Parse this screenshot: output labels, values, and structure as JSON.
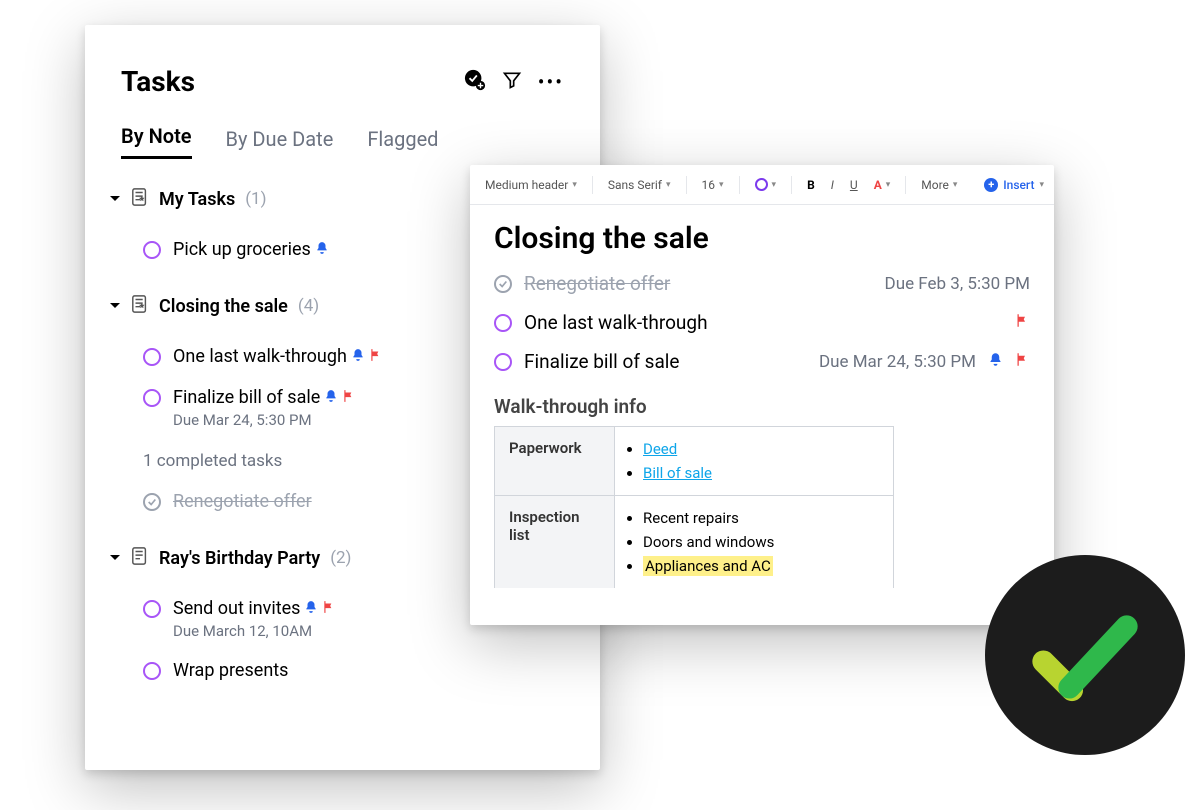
{
  "left": {
    "title": "Tasks",
    "tabs": {
      "byNote": "By Note",
      "byDueDate": "By Due Date",
      "flagged": "Flagged"
    },
    "groups": {
      "myTasks": {
        "name": "My Tasks",
        "count": "(1)",
        "tasks": {
          "t0": {
            "text": "Pick up groceries"
          }
        }
      },
      "closing": {
        "name": "Closing the sale",
        "count": "(4)",
        "tasks": {
          "t0": {
            "text": "One last walk-through"
          },
          "t1": {
            "text": "Finalize bill of sale",
            "sub": "Due Mar 24, 5:30 PM"
          }
        },
        "completedLabel": "1 completed tasks",
        "done0": {
          "text": "Renegotiate offer"
        }
      },
      "ray": {
        "name": "Ray's Birthday Party",
        "count": "(2)",
        "tasks": {
          "t0": {
            "text": "Send out invites",
            "sub": "Due March 12, 10AM"
          },
          "t1": {
            "text": "Wrap presents"
          }
        }
      }
    }
  },
  "editor": {
    "toolbar": {
      "style": "Medium header",
      "font": "Sans Serif",
      "size": "16",
      "bold": "B",
      "italic": "I",
      "underline": "U",
      "fontcolor": "A",
      "more": "More",
      "insert": "Insert"
    },
    "docTitle": "Closing the sale",
    "rows": {
      "done": {
        "text": "Renegotiate offer",
        "due": "Due Feb 3, 5:30 PM"
      },
      "r1": {
        "text": "One last walk-through"
      },
      "r2": {
        "text": "Finalize bill of sale",
        "due": "Due Mar 24, 5:30 PM"
      }
    },
    "sectionHeader": "Walk-through info",
    "table": {
      "paperwork": {
        "label": "Paperwork",
        "deed": "Deed",
        "bill": "Bill of sale"
      },
      "inspection": {
        "label": "Inspection list",
        "i0": "Recent repairs",
        "i1": "Doors and windows",
        "i2": "Appliances and AC"
      }
    }
  }
}
